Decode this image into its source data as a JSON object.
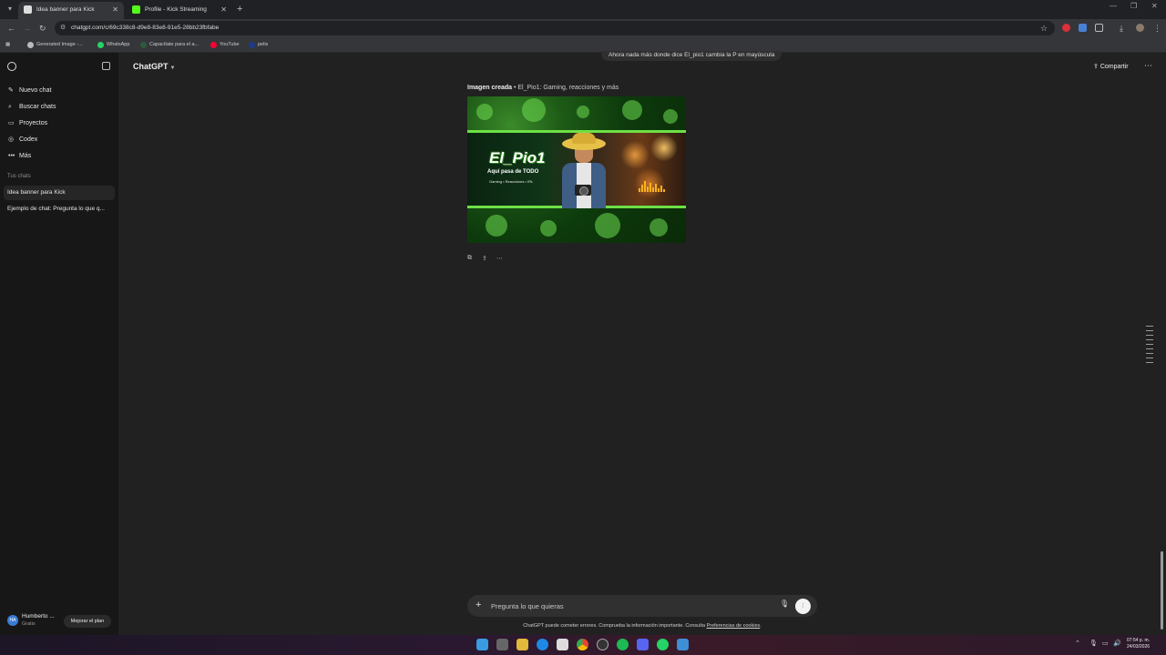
{
  "browser": {
    "tabs": [
      {
        "title": "Idea banner para Kick",
        "active": true
      },
      {
        "title": "Profile - Kick Streaming",
        "active": false
      }
    ],
    "url": "chatgpt.com/c/69c338c8-d9e8-83e8-91e5-28bb23fbfabe",
    "bookmarks": [
      "Generated Image -...",
      "WhatsApp",
      "Capacítate para el a...",
      "YouTube",
      "pelis"
    ]
  },
  "sidebar": {
    "items": [
      {
        "label": "Nuevo chat",
        "icon": "edit-icon"
      },
      {
        "label": "Buscar chats",
        "icon": "search-icon"
      },
      {
        "label": "Proyectos",
        "icon": "folder-icon"
      },
      {
        "label": "Codex",
        "icon": "codex-icon"
      },
      {
        "label": "Más",
        "icon": "more-icon"
      }
    ],
    "section_title": "Tus chats",
    "chats": [
      {
        "label": "Idea banner para Kick",
        "active": true
      },
      {
        "label": "Ejemplo de chat: Pregunta lo que q...",
        "active": false
      }
    ],
    "user": {
      "initials": "HA",
      "name": "Humberto ...",
      "plan": "Gratis",
      "upgrade_label": "Mejorar el plan"
    }
  },
  "header": {
    "model": "ChatGPT",
    "share_label": "Compartir"
  },
  "conversation": {
    "previous_message": "Ahora nada más donde dice El_pio1 cambia la P en mayúscula",
    "image_caption_prefix": "Imagen creada",
    "image_caption_title": "• El_Pio1: Gaming, reacciones y más",
    "banner": {
      "title": "El_Pio1",
      "subtitle": "Aquí pasa de TODO",
      "tags": "Gaming • Reacciones • IRL"
    }
  },
  "composer": {
    "placeholder": "Pregunta lo que quieras"
  },
  "disclaimer": {
    "text": "ChatGPT puede cometer errores. Comprueba la información importante. Consulta ",
    "link": "Preferencias de cookies",
    "end": "."
  },
  "taskbar": {
    "time": "07:54 p. m.",
    "date": "24/03/2026"
  },
  "colors": {
    "sidebar_bg": "#171717",
    "main_bg": "#212121",
    "banner_green": "#6de046"
  }
}
